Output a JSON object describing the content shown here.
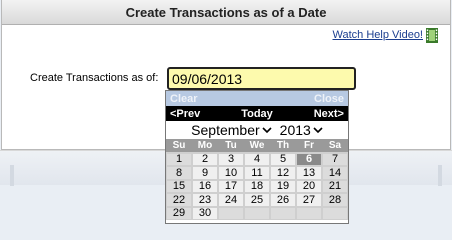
{
  "panel": {
    "title": "Create Transactions as of a Date",
    "help_link": "Watch Help Video!"
  },
  "form": {
    "label": "Create Transactions as of:",
    "date_value": "09/06/2013"
  },
  "calendar": {
    "clear": "Clear",
    "close": "Close",
    "prev": "<Prev",
    "today": "Today",
    "next": "Next>",
    "month": "September",
    "year": "2013",
    "weekdays": [
      "Su",
      "Mo",
      "Tu",
      "We",
      "Th",
      "Fr",
      "Sa"
    ],
    "weeks": [
      [
        "1",
        "2",
        "3",
        "4",
        "5",
        "6",
        "7"
      ],
      [
        "8",
        "9",
        "10",
        "11",
        "12",
        "13",
        "14"
      ],
      [
        "15",
        "16",
        "17",
        "18",
        "19",
        "20",
        "21"
      ],
      [
        "22",
        "23",
        "24",
        "25",
        "26",
        "27",
        "28"
      ],
      [
        "29",
        "30",
        "",
        "",
        "",
        "",
        ""
      ]
    ],
    "selected_day": "6"
  },
  "colors": {
    "input_bg": "#fdfaad",
    "calendar_nav": "#000000",
    "calendar_clear_bar": "#b7c9e2",
    "weekday_header": "#9a9a9a",
    "link": "#1a3d8f"
  }
}
